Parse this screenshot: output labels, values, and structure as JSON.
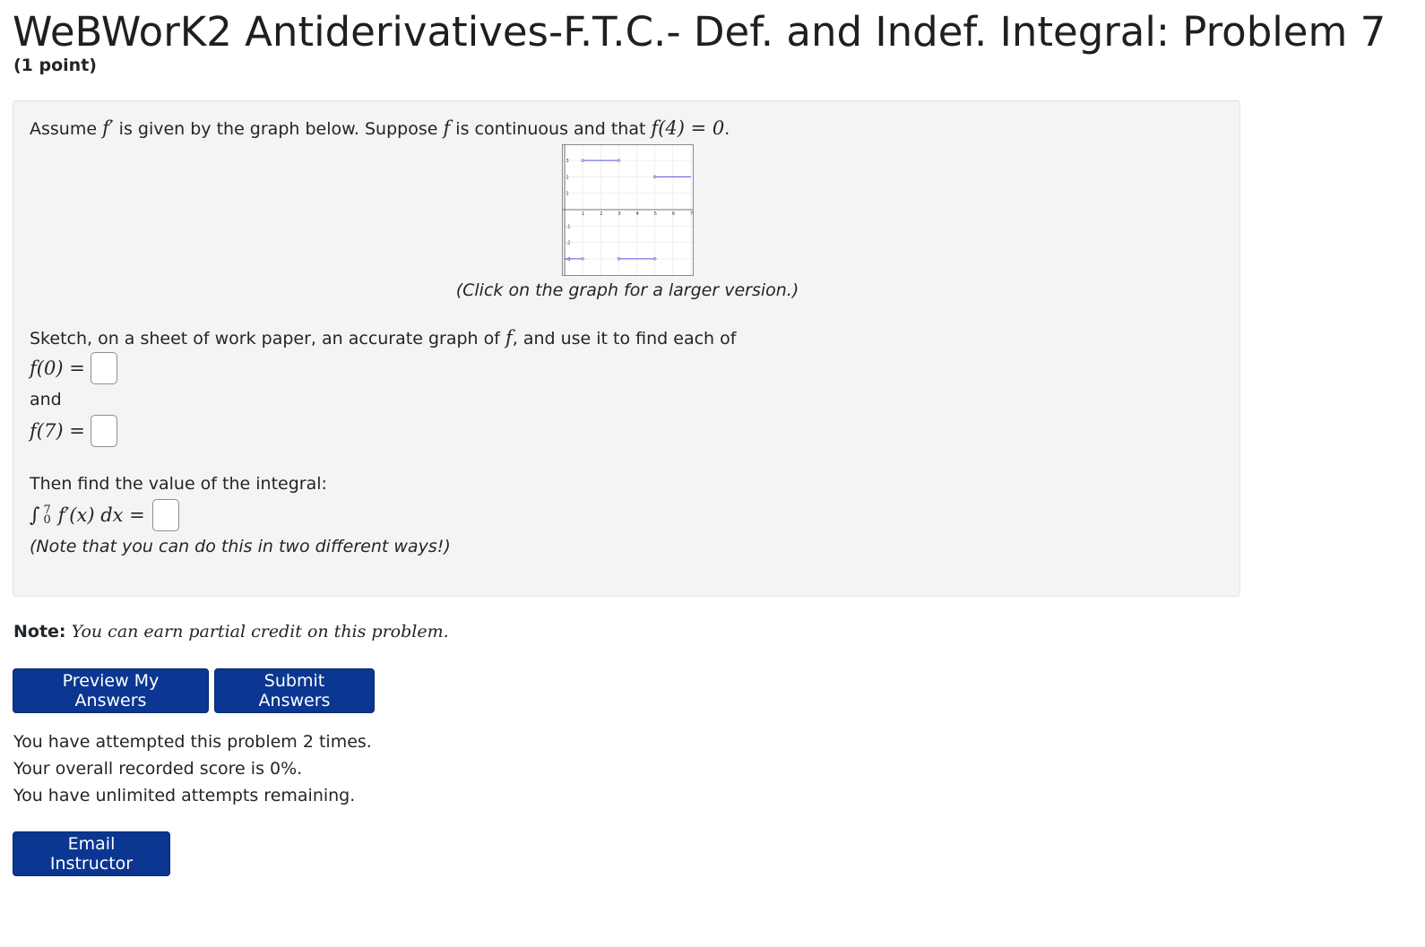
{
  "header": {
    "title": "WeBWorK2 Antiderivatives-F.T.C.- Def. and Indef. Integral: Problem 7",
    "points": "(1 point)"
  },
  "problem": {
    "intro_pre": "Assume ",
    "intro_fprime": "f′",
    "intro_mid1": " is given by the graph below. Suppose ",
    "intro_f": "f",
    "intro_mid2": " is continuous and that ",
    "intro_cond": "f(4) = 0",
    "intro_end": ".",
    "graph_caption": "(Click on the graph for a larger version.)",
    "sketch_pre": "Sketch, on a sheet of work paper, an accurate graph of ",
    "sketch_f": "f",
    "sketch_post": ", and use it to find each of",
    "q1_label": "f(0) =",
    "q1_value": "",
    "and_text": "and",
    "q2_label": "f(7) =",
    "q2_value": "",
    "integral_prompt": "Then find the value of the integral:",
    "integral_sign": "∫",
    "integral_upper": "7",
    "integral_lower": "0",
    "integral_body": "f′(x) dx =",
    "q3_value": "",
    "integral_note": "(Note that you can do this in two different ways!)"
  },
  "graph": {
    "line_color": "#5555dd",
    "x_ticks": [
      "1",
      "2",
      "3",
      "4",
      "5",
      "6",
      "7"
    ],
    "y_ticks": [
      "3",
      "2",
      "1",
      "-1",
      "-2",
      "-3"
    ],
    "segments": [
      {
        "x0": 0,
        "x1": 1,
        "y": -3
      },
      {
        "x0": 1,
        "x1": 3,
        "y": 3
      },
      {
        "x0": 3,
        "x1": 5,
        "y": -3
      },
      {
        "x0": 5,
        "x1": 7,
        "y": 2
      }
    ]
  },
  "note": {
    "label": "Note:",
    "text": "You can earn partial credit on this problem."
  },
  "buttons": {
    "preview": "Preview My Answers",
    "submit": "Submit Answers",
    "email": "Email Instructor"
  },
  "status": {
    "attempts": "You have attempted this problem 2 times.",
    "score": "Your overall recorded score is 0%.",
    "remaining": "You have unlimited attempts remaining."
  },
  "colors": {
    "button_bg": "#0b3691",
    "panel_bg": "#f4f4f4"
  }
}
